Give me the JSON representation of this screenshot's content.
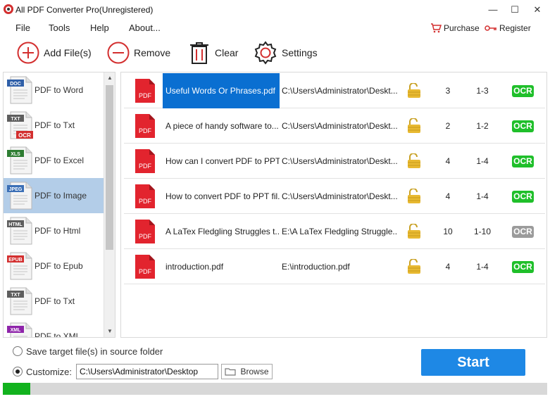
{
  "window": {
    "title": "All PDF Converter Pro(Unregistered)",
    "minimize": "—",
    "maximize": "☐",
    "close": "✕"
  },
  "menu": {
    "items": [
      "File",
      "Tools",
      "Help",
      "About..."
    ],
    "purchase": "Purchase",
    "register": "Register"
  },
  "toolbar": {
    "add": "Add File(s)",
    "remove": "Remove",
    "clear": "Clear",
    "settings": "Settings"
  },
  "sidebar": {
    "items": [
      {
        "label": "PDF to Word",
        "badge": "DOC",
        "color": "#2f5fa8"
      },
      {
        "label": "PDF to Txt",
        "badge": "TXT",
        "color": "#5e5e5e",
        "sub": "OCR"
      },
      {
        "label": "PDF to Excel",
        "badge": "XLS",
        "color": "#2e7d32"
      },
      {
        "label": "PDF to Image",
        "badge": "JPEG",
        "color": "#3b6fb6",
        "active": true
      },
      {
        "label": "PDF to Html",
        "badge": "HTML",
        "color": "#5e5e5e"
      },
      {
        "label": "PDF to Epub",
        "badge": "EPUB",
        "color": "#d32f2f"
      },
      {
        "label": "PDF to Txt",
        "badge": "TXT",
        "color": "#5e5e5e"
      },
      {
        "label": "PDF to XML",
        "badge": "XML",
        "color": "#8e24aa"
      }
    ],
    "scroll_up": "▲",
    "scroll_down": "▼"
  },
  "files": {
    "pdf_label": "PDF",
    "rows": [
      {
        "name": "Useful Words Or Phrases.pdf",
        "path": "C:\\Users\\Administrator\\Deskt...",
        "pages": "3",
        "range": "1-3",
        "ocr": "OCR",
        "ocr_on": true,
        "selected": true
      },
      {
        "name": "A piece of handy software to...",
        "path": "C:\\Users\\Administrator\\Deskt...",
        "pages": "2",
        "range": "1-2",
        "ocr": "OCR",
        "ocr_on": true
      },
      {
        "name": "How can I convert PDF to PPT...",
        "path": "C:\\Users\\Administrator\\Deskt...",
        "pages": "4",
        "range": "1-4",
        "ocr": "OCR",
        "ocr_on": true
      },
      {
        "name": "How to convert PDF to PPT fil...",
        "path": "C:\\Users\\Administrator\\Deskt...",
        "pages": "4",
        "range": "1-4",
        "ocr": "OCR",
        "ocr_on": true
      },
      {
        "name": "A LaTex Fledgling Struggles t...",
        "path": "E:\\A LaTex Fledgling Struggle...",
        "pages": "10",
        "range": "1-10",
        "ocr": "OCR",
        "ocr_on": false
      },
      {
        "name": "introduction.pdf",
        "path": "E:\\introduction.pdf",
        "pages": "4",
        "range": "1-4",
        "ocr": "OCR",
        "ocr_on": true
      }
    ]
  },
  "output": {
    "source_option": "Save target file(s) in source folder",
    "customize_option": "Customize:",
    "path": "C:\\Users\\Administrator\\Desktop",
    "browse": "Browse",
    "start": "Start"
  },
  "progress": {
    "value": 0.05
  }
}
